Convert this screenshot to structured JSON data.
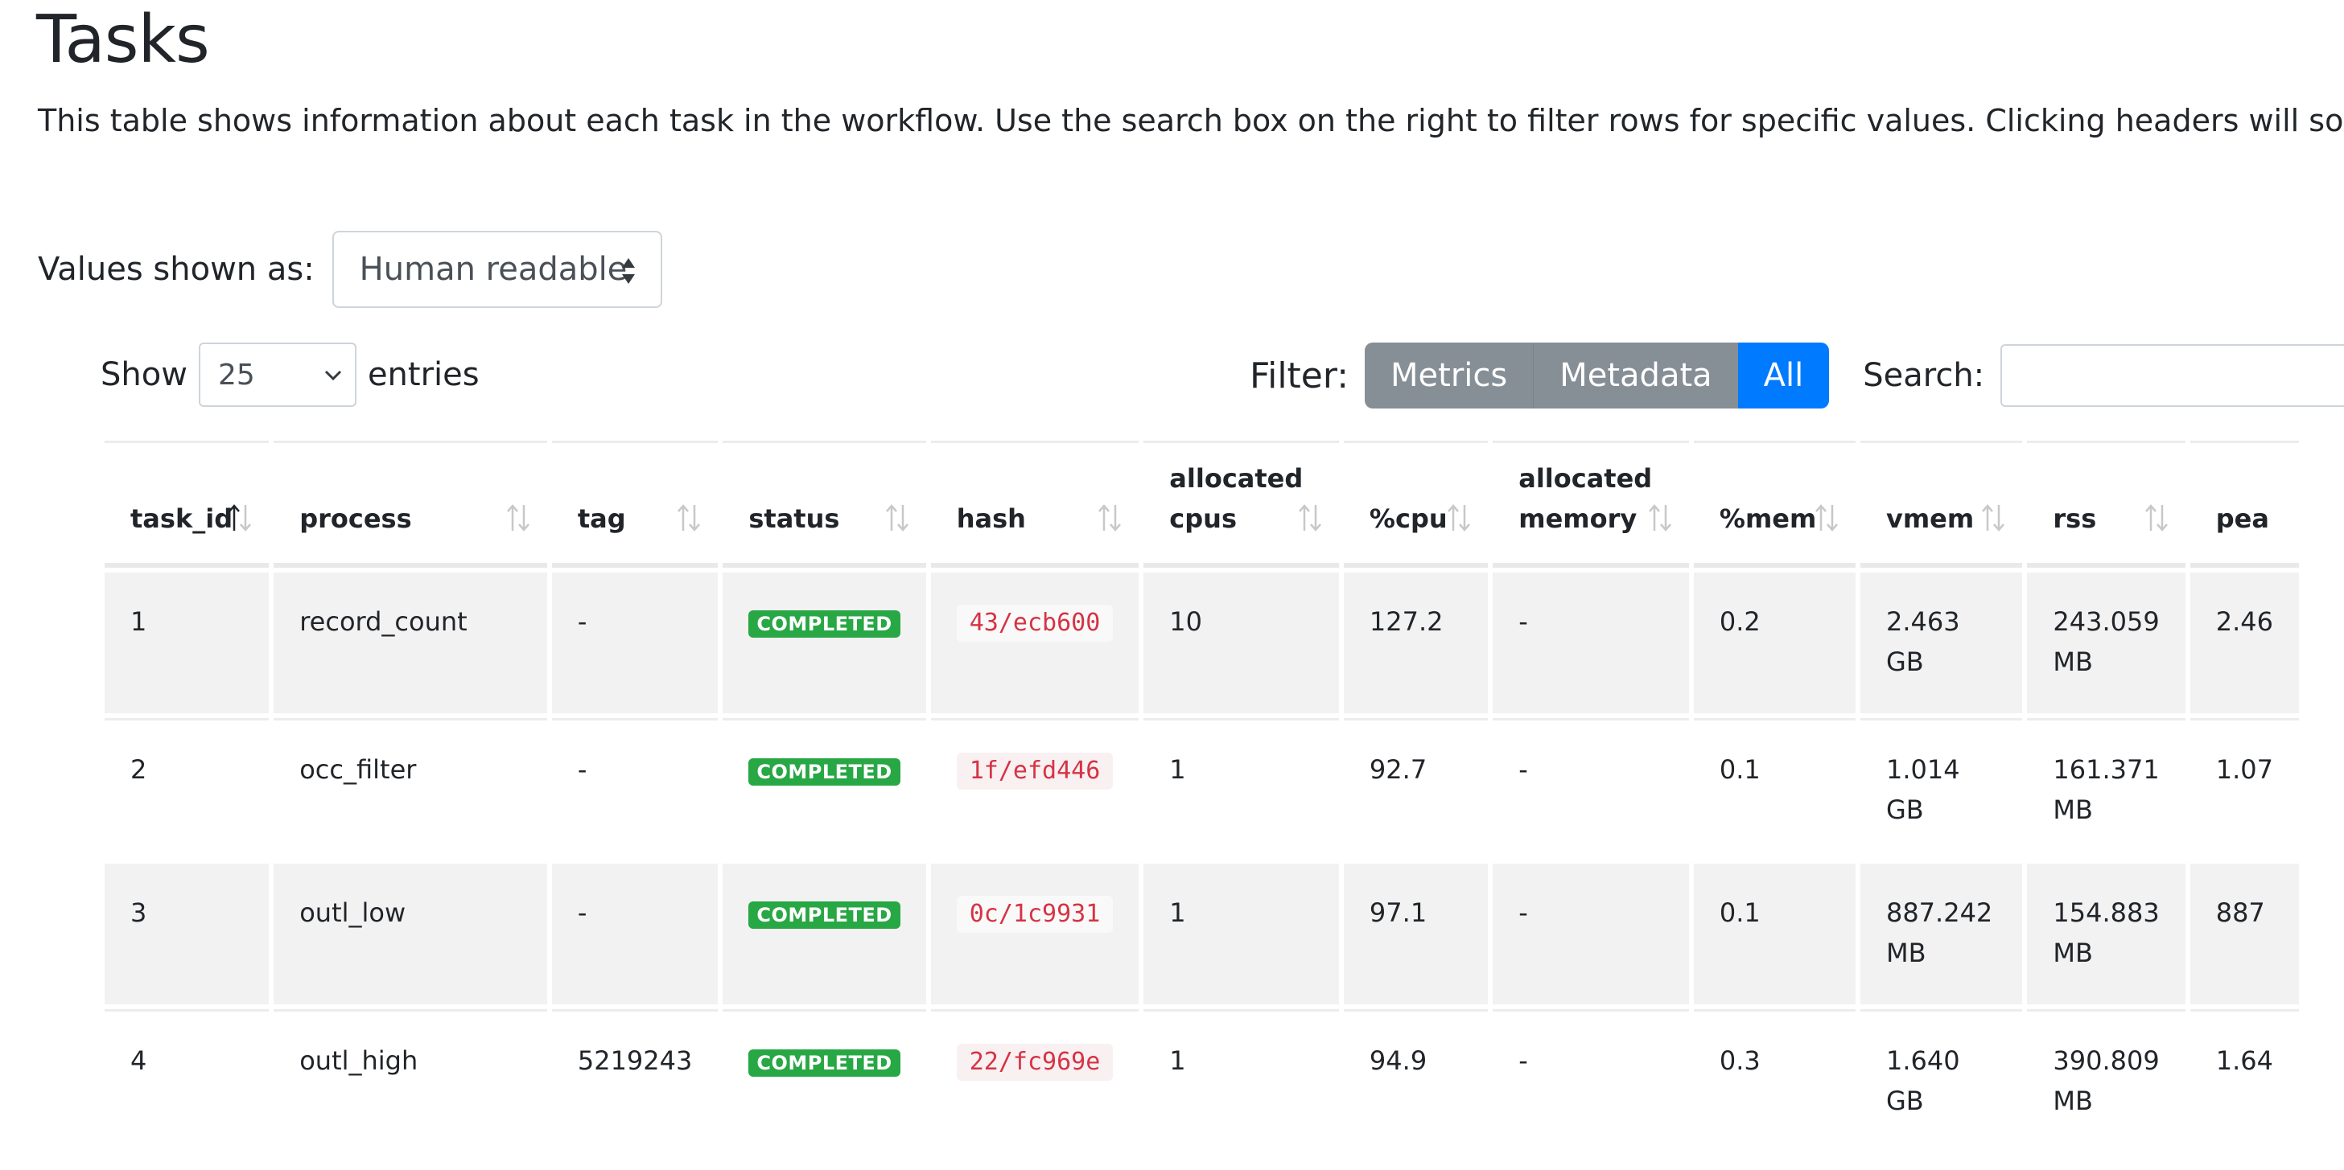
{
  "page": {
    "title": "Tasks",
    "description": "This table shows information about each task in the workflow. Use the search box on the right to filter rows for specific values. Clicking headers will sort the table by that value and scrolling side to side will reveal more columns."
  },
  "values_shown": {
    "label": "Values shown as:",
    "selected": "Human readable"
  },
  "length_control": {
    "prefix": "Show",
    "selected": "25",
    "suffix": "entries"
  },
  "filter": {
    "label": "Filter:",
    "buttons": [
      "Metrics",
      "Metadata",
      "All"
    ],
    "active": "All"
  },
  "search": {
    "label": "Search:",
    "value": ""
  },
  "table": {
    "columns": [
      {
        "line1": "task_id",
        "line2": ""
      },
      {
        "line1": "process",
        "line2": ""
      },
      {
        "line1": "tag",
        "line2": ""
      },
      {
        "line1": "status",
        "line2": ""
      },
      {
        "line1": "hash",
        "line2": ""
      },
      {
        "line1": "allocated",
        "line2": "cpus"
      },
      {
        "line1": "%cpu",
        "line2": ""
      },
      {
        "line1": "allocated",
        "line2": "memory"
      },
      {
        "line1": "%mem",
        "line2": ""
      },
      {
        "line1": "vmem",
        "line2": ""
      },
      {
        "line1": "rss",
        "line2": ""
      },
      {
        "line1": "pea",
        "line2": ""
      }
    ],
    "rows": [
      {
        "task_id": "1",
        "process": "record_count",
        "tag": "-",
        "status": "COMPLETED",
        "hash": "43/ecb600",
        "allocated_cpus": "10",
        "cpu_pct": "127.2",
        "allocated_memory": "-",
        "mem_pct": "0.2",
        "vmem_1": "2.463 GB",
        "vmem_2": "",
        "rss_1": "243.059",
        "rss_2": "MB",
        "peak": "2.46"
      },
      {
        "task_id": "2",
        "process": "occ_filter",
        "tag": "-",
        "status": "COMPLETED",
        "hash": "1f/efd446",
        "allocated_cpus": "1",
        "cpu_pct": "92.7",
        "allocated_memory": "-",
        "mem_pct": "0.1",
        "vmem_1": "1.014 GB",
        "vmem_2": "",
        "rss_1": "161.371",
        "rss_2": "MB",
        "peak": "1.07"
      },
      {
        "task_id": "3",
        "process": "outl_low",
        "tag": "-",
        "status": "COMPLETED",
        "hash": "0c/1c9931",
        "allocated_cpus": "1",
        "cpu_pct": "97.1",
        "allocated_memory": "-",
        "mem_pct": "0.1",
        "vmem_1": "887.242",
        "vmem_2": "MB",
        "rss_1": "154.883",
        "rss_2": "MB",
        "peak": "887"
      },
      {
        "task_id": "4",
        "process": "outl_high",
        "tag": "5219243",
        "status": "COMPLETED",
        "hash": "22/fc969e",
        "allocated_cpus": "1",
        "cpu_pct": "94.9",
        "allocated_memory": "-",
        "mem_pct": "0.3",
        "vmem_1": "1.640 GB",
        "vmem_2": "",
        "rss_1": "390.809",
        "rss_2": "MB",
        "peak": "1.64"
      }
    ]
  },
  "colors": {
    "badge_completed": "#28a745",
    "hash_text": "#d63344",
    "filter_active": "#007bff",
    "filter_inactive": "#868e96",
    "row_stripe": "#f2f2f2"
  },
  "icons": {
    "sort": "sort-arrows-icon",
    "select": "select-arrows-icon",
    "chevron": "chevron-down-icon"
  }
}
